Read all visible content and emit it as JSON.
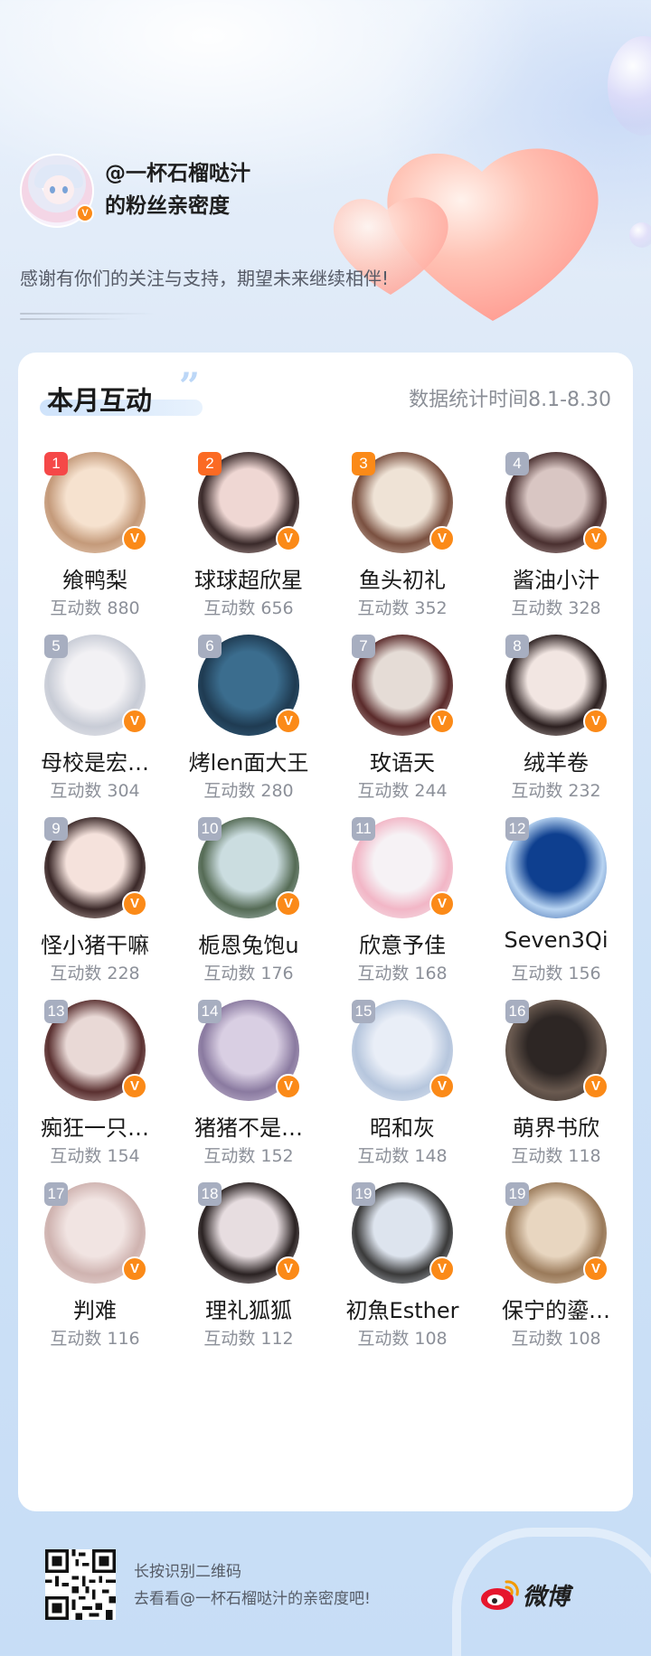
{
  "header": {
    "title": "@一杯石榴哒汁\n的粉丝亲密度",
    "subtitle": "感谢有你们的关注与支持，期望未来继续相伴!",
    "verified_mark": "V"
  },
  "card": {
    "section_title": "本月互动",
    "quote_mark": "”",
    "stat_period": "数据统计时间8.1-8.30"
  },
  "fans": [
    {
      "rank": "1",
      "name": "飨鸭梨",
      "count": "互动数 880",
      "rank_color": "#f54848"
    },
    {
      "rank": "2",
      "name": "球球超欣星",
      "count": "互动数 656",
      "rank_color": "#fb6a23"
    },
    {
      "rank": "3",
      "name": "鱼头初礼",
      "count": "互动数 352",
      "rank_color": "#fb8a18"
    },
    {
      "rank": "4",
      "name": "酱油小汁",
      "count": "互动数 328",
      "rank_color": "#a7aec0"
    },
    {
      "rank": "5",
      "name": "母校是宏…",
      "count": "互动数 304",
      "rank_color": "#a7aec0"
    },
    {
      "rank": "6",
      "name": "烤len面大王",
      "count": "互动数 280",
      "rank_color": "#a7aec0"
    },
    {
      "rank": "7",
      "name": "玫语天",
      "count": "互动数 244",
      "rank_color": "#a7aec0"
    },
    {
      "rank": "8",
      "name": "绒羊卷",
      "count": "互动数 232",
      "rank_color": "#a7aec0"
    },
    {
      "rank": "9",
      "name": "怪小猪干嘛",
      "count": "互动数 228",
      "rank_color": "#a7aec0"
    },
    {
      "rank": "10",
      "name": "栀恩兔饱u",
      "count": "互动数 176",
      "rank_color": "#a7aec0"
    },
    {
      "rank": "11",
      "name": "欣意予佳",
      "count": "互动数 168",
      "rank_color": "#a7aec0"
    },
    {
      "rank": "12",
      "name": "Seven3Qi",
      "count": "互动数 156",
      "rank_color": "#a7aec0"
    },
    {
      "rank": "13",
      "name": "痴狂一只…",
      "count": "互动数 154",
      "rank_color": "#a7aec0"
    },
    {
      "rank": "14",
      "name": "猪猪不是…",
      "count": "互动数 152",
      "rank_color": "#a7aec0"
    },
    {
      "rank": "15",
      "name": "昭和灰",
      "count": "互动数 148",
      "rank_color": "#a7aec0"
    },
    {
      "rank": "16",
      "name": "萌界书欣",
      "count": "互动数 118",
      "rank_color": "#a7aec0"
    },
    {
      "rank": "17",
      "name": "判难",
      "count": "互动数 116",
      "rank_color": "#a7aec0"
    },
    {
      "rank": "18",
      "name": "理礼狐狐",
      "count": "互动数 112",
      "rank_color": "#a7aec0"
    },
    {
      "rank": "19",
      "name": "初魚Esther",
      "count": "互动数 108",
      "rank_color": "#a7aec0"
    },
    {
      "rank": "19",
      "name": "保宁的鎏…",
      "count": "互动数 108",
      "rank_color": "#a7aec0"
    }
  ],
  "footer": {
    "qr_hint": "长按识别二维码\n去看看@一杯石榴哒汁的亲密度吧!",
    "brand": "微博"
  }
}
